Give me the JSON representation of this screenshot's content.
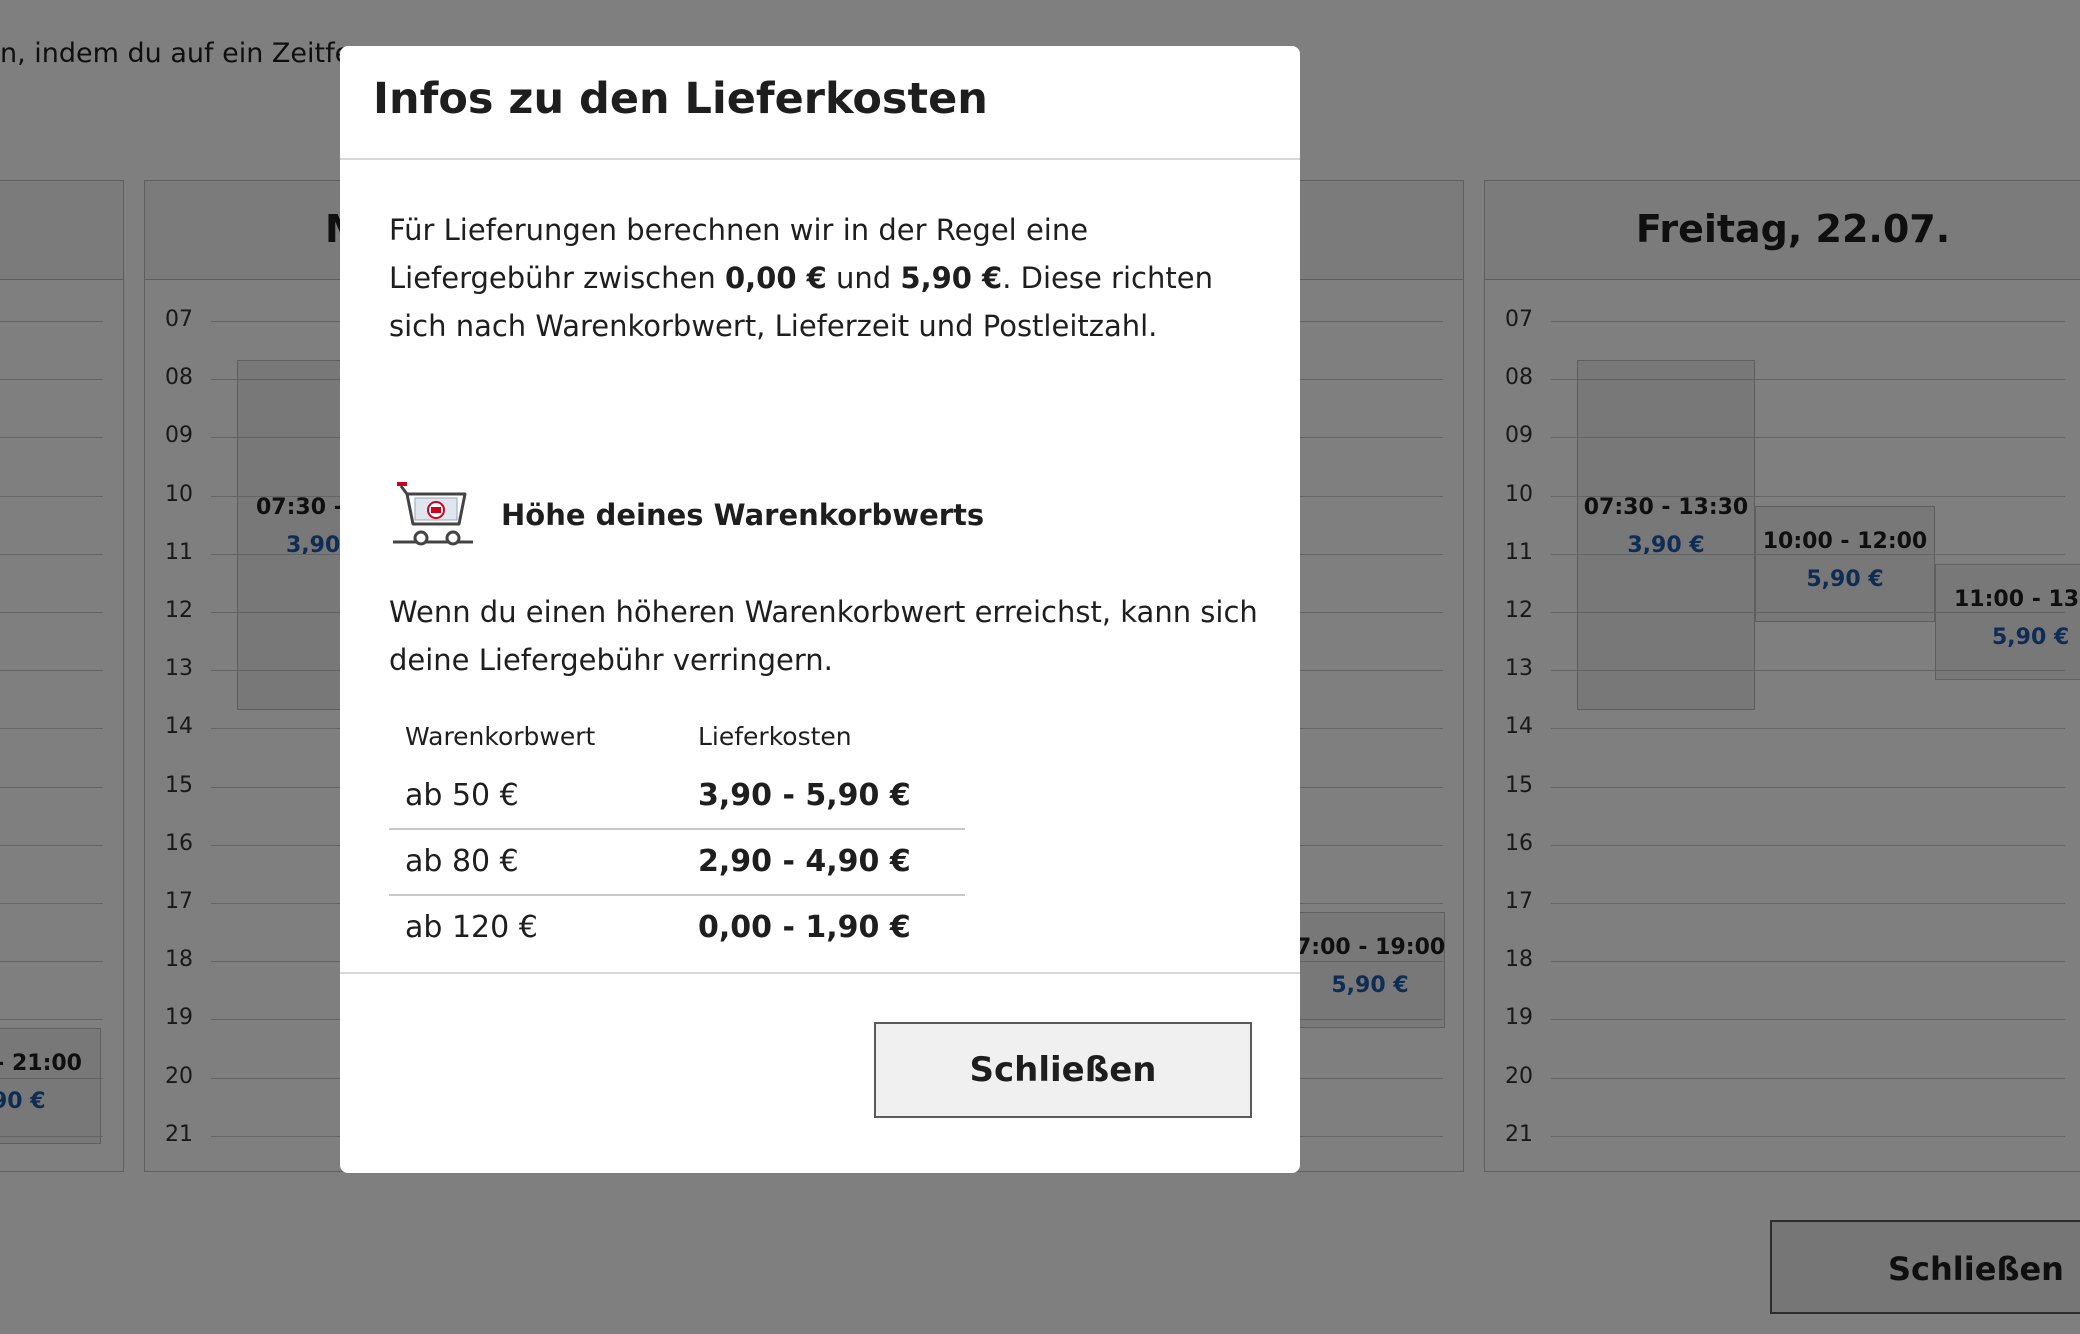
{
  "background": {
    "intro_text": "n, indem du auf ein Zeitfe",
    "day_title_partial": "M",
    "day_title_friday": "Freitag, 22.07.",
    "hours": [
      "07",
      "08",
      "09",
      "10",
      "11",
      "12",
      "13",
      "14",
      "15",
      "16",
      "17",
      "18",
      "19",
      "20",
      "21"
    ],
    "slots": [
      {
        "time": "07:30 - 1",
        "price": "3,90"
      },
      {
        "time": "0 - 21:00",
        "price": "90 €"
      },
      {
        "time": "7:00 - 19:00",
        "price": "5,90 €"
      },
      {
        "time": "07:30 - 13:30",
        "price": "3,90 €"
      },
      {
        "time": "10:00 - 12:00",
        "price": "5,90 €"
      },
      {
        "time": "11:00 - 13:",
        "price": "5,90 €"
      }
    ],
    "close_label": "Schließen"
  },
  "modal": {
    "title": "Infos zu den Lieferkosten",
    "intro": {
      "part1": "Für Lieferungen berechnen wir in der Regel eine Liefergebühr zwischen ",
      "min_fee": "0,00 €",
      "part2": " und ",
      "max_fee": "5,90 €",
      "part3": ". Diese richten sich nach Warenkorbwert, Lieferzeit und Postleitzahl."
    },
    "section_title": "Höhe deines Warenkorbwerts",
    "section_text": "Wenn du einen höheren Warenkorbwert erreichst, kann sich deine Liefergebühr verringern.",
    "table": {
      "headers": [
        "Warenkorbwert",
        "Lieferkosten"
      ],
      "rows": [
        [
          "ab 50 €",
          "3,90 - 5,90 €"
        ],
        [
          "ab 80 €",
          "2,90 - 4,90 €"
        ],
        [
          "ab 120 €",
          "0,00 - 1,90 €"
        ]
      ]
    },
    "close_label": "Schließen"
  },
  "colors": {
    "price_blue": "#1f5aa8",
    "overlay": "rgba(0,0,0,0.5)",
    "cart_accent": "#d0021b"
  },
  "icons": {
    "cart": "shopping-cart-icon"
  }
}
